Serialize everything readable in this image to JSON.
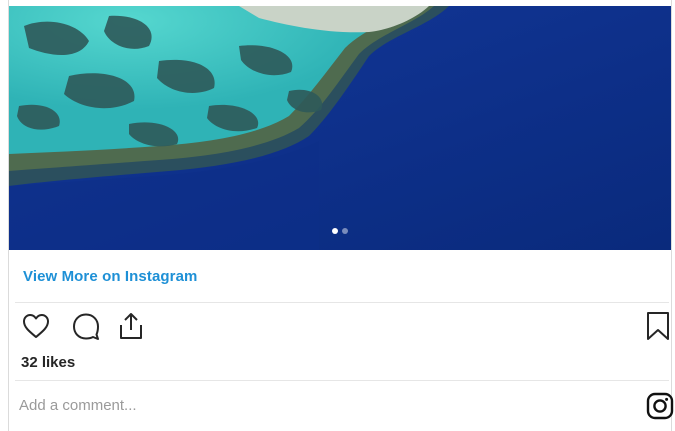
{
  "post": {
    "photo_alt": "Aerial view of coral reef and deep blue ocean",
    "carousel": {
      "count": 2,
      "active_index": 0
    },
    "view_more_label": "View More on Instagram",
    "likes_text": "32 likes",
    "comment_placeholder": "Add a comment...",
    "icons": {
      "like": "heart-icon",
      "comment": "comment-icon",
      "share": "share-icon",
      "save": "bookmark-icon",
      "brand": "instagram-logo-icon"
    },
    "colors": {
      "link": "#1e90d6",
      "text": "#262626",
      "placeholder": "#9a9a9a",
      "ocean": "#0c2f86"
    }
  }
}
